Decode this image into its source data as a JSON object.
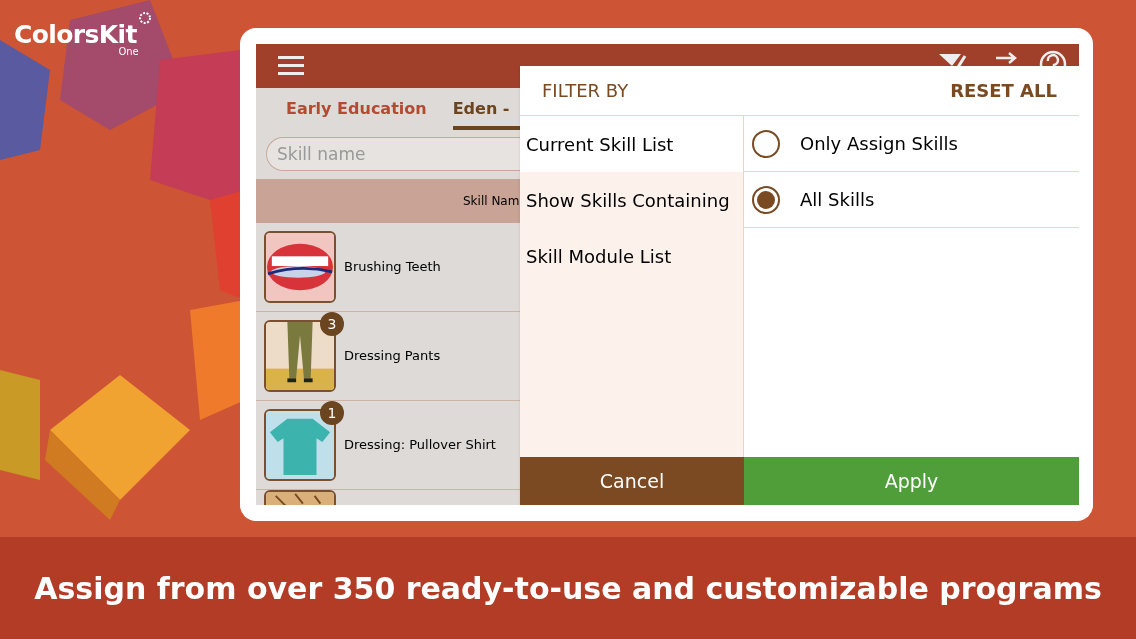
{
  "logo": {
    "name": "ColorsKit",
    "sub": "One"
  },
  "app": {
    "tabs": [
      {
        "label": "Early Education",
        "selected": false
      },
      {
        "label": "Eden -",
        "selected": true
      }
    ],
    "search": {
      "placeholder": "Skill name"
    },
    "column_header": "Skill Nam",
    "skills": [
      {
        "name": "Brushing Teeth",
        "kind": "teeth"
      },
      {
        "name": "Dressing Pants",
        "kind": "pants",
        "badge": "3"
      },
      {
        "name": "Dressing: Pullover Shirt",
        "kind": "shirt",
        "badge": "1"
      },
      {
        "kind": "partial"
      }
    ]
  },
  "filter": {
    "title": "FILTER BY",
    "reset": "RESET ALL",
    "categories": [
      {
        "label": "Current Skill List",
        "selected": true
      },
      {
        "label": "Show Skills Containing",
        "selected": false
      },
      {
        "label": "Skill Module List",
        "selected": false
      }
    ],
    "options": [
      {
        "label": "Only Assign Skills",
        "selected": false
      },
      {
        "label": "All Skills",
        "selected": true
      }
    ],
    "buttons": [
      {
        "label": "Cancel",
        "kind": "cancel"
      },
      {
        "label": "Apply",
        "kind": "apply"
      }
    ]
  },
  "caption": "Assign from over 350 ready-to-use and customizable programs"
}
